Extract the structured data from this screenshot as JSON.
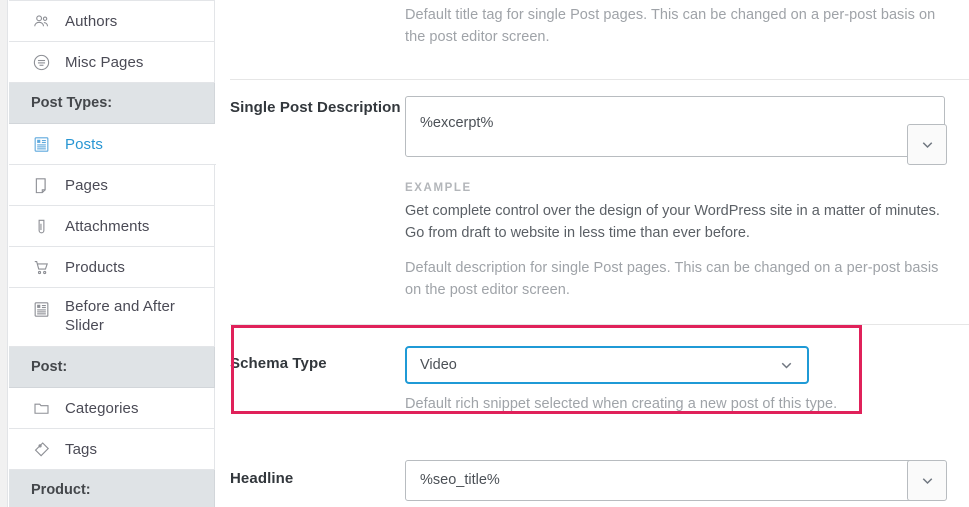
{
  "sidebar": {
    "items": [
      {
        "label": "Authors",
        "icon": "authors-icon",
        "type": "item",
        "active": false
      },
      {
        "label": "Misc Pages",
        "icon": "misc-pages-icon",
        "type": "item",
        "active": false
      },
      {
        "label": "Post Types:",
        "icon": "",
        "type": "heading",
        "active": false
      },
      {
        "label": "Posts",
        "icon": "posts-icon",
        "type": "item",
        "active": true
      },
      {
        "label": "Pages",
        "icon": "pages-icon",
        "type": "item",
        "active": false
      },
      {
        "label": "Attachments",
        "icon": "attachment-icon",
        "type": "item",
        "active": false
      },
      {
        "label": "Products",
        "icon": "cart-icon",
        "type": "item",
        "active": false
      },
      {
        "label": "Before and After Slider",
        "icon": "slider-icon",
        "type": "item",
        "active": false
      },
      {
        "label": "Post:",
        "icon": "",
        "type": "heading",
        "active": false
      },
      {
        "label": "Categories",
        "icon": "folder-icon",
        "type": "item",
        "active": false
      },
      {
        "label": "Tags",
        "icon": "tag-icon",
        "type": "item",
        "active": false
      },
      {
        "label": "Product:",
        "icon": "",
        "type": "heading",
        "active": false
      }
    ]
  },
  "main": {
    "title_tag_help": "Default title tag for single Post pages. This can be changed on a per-post basis on the post editor screen.",
    "single_post_description": {
      "label": "Single Post Description",
      "value": "%excerpt%",
      "example_label": "EXAMPLE",
      "example_text": "Get complete control over the design of your WordPress site in a matter of minutes. Go from draft to website in less time than ever before.",
      "help": "Default description for single Post pages. This can be changed on a per-post basis on the post editor screen."
    },
    "schema_type": {
      "label": "Schema Type",
      "value": "Video",
      "help": "Default rich snippet selected when creating a new post of this type.",
      "options": [
        "Video"
      ]
    },
    "headline": {
      "label": "Headline",
      "value": "%seo_title%"
    }
  },
  "colors": {
    "highlight": "#e0215a",
    "select_border": "#1f9ad6",
    "active_nav": "#2896d3"
  }
}
